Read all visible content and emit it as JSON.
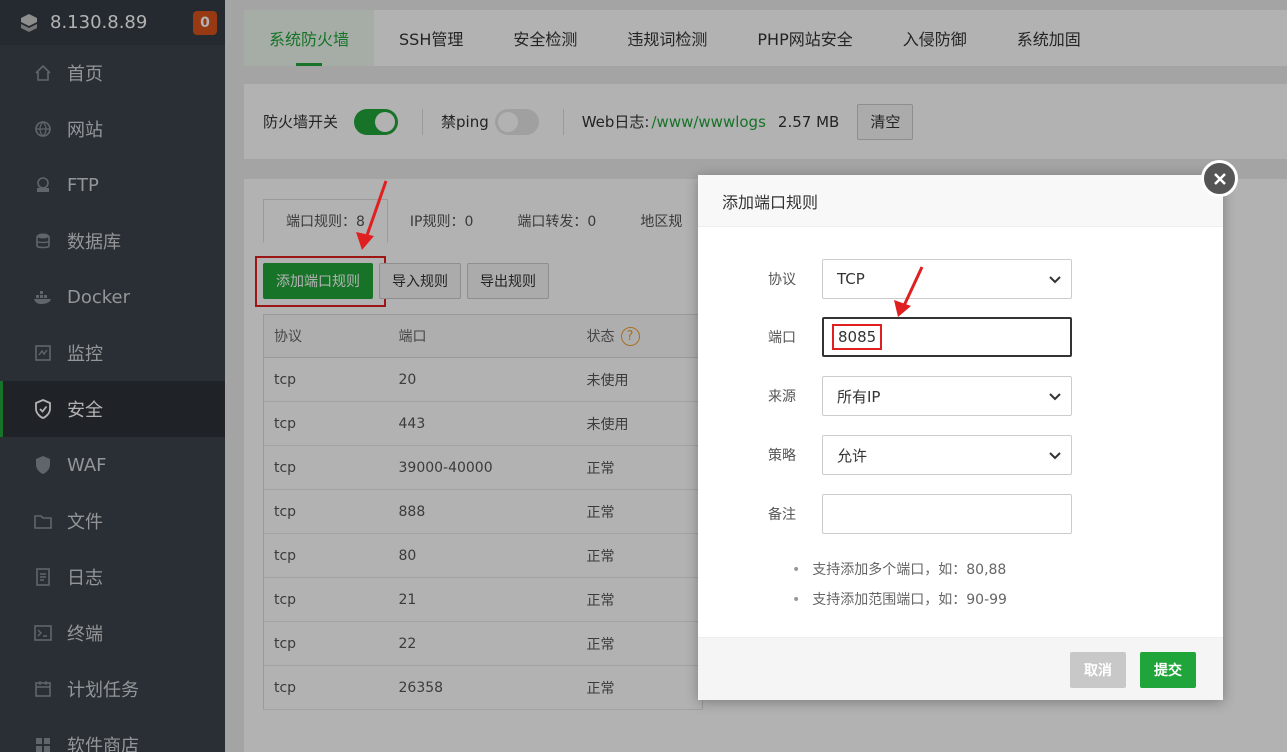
{
  "sidebar": {
    "server_ip": "8.130.8.89",
    "badge_count": "0",
    "items": [
      {
        "label": "首页",
        "icon": "home-icon"
      },
      {
        "label": "网站",
        "icon": "globe-icon"
      },
      {
        "label": "FTP",
        "icon": "ftp-icon"
      },
      {
        "label": "数据库",
        "icon": "database-icon"
      },
      {
        "label": "Docker",
        "icon": "docker-icon"
      },
      {
        "label": "监控",
        "icon": "monitor-icon"
      },
      {
        "label": "安全",
        "icon": "shield-icon",
        "active": true
      },
      {
        "label": "WAF",
        "icon": "waf-shield-icon"
      },
      {
        "label": "文件",
        "icon": "folder-icon"
      },
      {
        "label": "日志",
        "icon": "log-icon"
      },
      {
        "label": "终端",
        "icon": "terminal-icon"
      },
      {
        "label": "计划任务",
        "icon": "calendar-icon"
      },
      {
        "label": "软件商店",
        "icon": "store-icon"
      }
    ]
  },
  "top_tabs": [
    "系统防火墙",
    "SSH管理",
    "安全检测",
    "违规词检测",
    "PHP网站安全",
    "入侵防御",
    "系统加固"
  ],
  "firewall_bar": {
    "firewall_switch_label": "防火墙开关",
    "firewall_on": true,
    "ping_label": "禁ping",
    "ping_on": false,
    "weblog_label": "Web日志:",
    "weblog_path": "/www/wwwlogs",
    "weblog_size": "2.57 MB",
    "clear_label": "清空"
  },
  "rules_tabs": [
    "端口规则：8",
    "IP规则：0",
    "端口转发：0",
    "地区规"
  ],
  "buttons": {
    "add_port_rule": "添加端口规则",
    "import_rules": "导入规则",
    "export_rules": "导出规则"
  },
  "table": {
    "headers": [
      "协议",
      "端口",
      "状态"
    ],
    "help": "?",
    "rows": [
      [
        "tcp",
        "20",
        "未使用"
      ],
      [
        "tcp",
        "443",
        "未使用"
      ],
      [
        "tcp",
        "39000-40000",
        "正常"
      ],
      [
        "tcp",
        "888",
        "正常"
      ],
      [
        "tcp",
        "80",
        "正常"
      ],
      [
        "tcp",
        "21",
        "正常"
      ],
      [
        "tcp",
        "22",
        "正常"
      ],
      [
        "tcp",
        "26358",
        "正常"
      ]
    ]
  },
  "dialog": {
    "title": "添加端口规则",
    "protocol_label": "协议",
    "protocol_value": "TCP",
    "port_label": "端口",
    "port_value": "8085",
    "source_label": "来源",
    "source_value": "所有IP",
    "strategy_label": "策略",
    "strategy_value": "允许",
    "remark_label": "备注",
    "remark_value": "",
    "hints": [
      "支持添加多个端口，如：80,88",
      "支持添加范围端口，如：90-99"
    ],
    "cancel_label": "取消",
    "submit_label": "提交"
  },
  "colors": {
    "accent": "#20a53a",
    "sidebar_bg": "#3c444d",
    "badge": "#d9541e",
    "highlight": "#e02020"
  }
}
